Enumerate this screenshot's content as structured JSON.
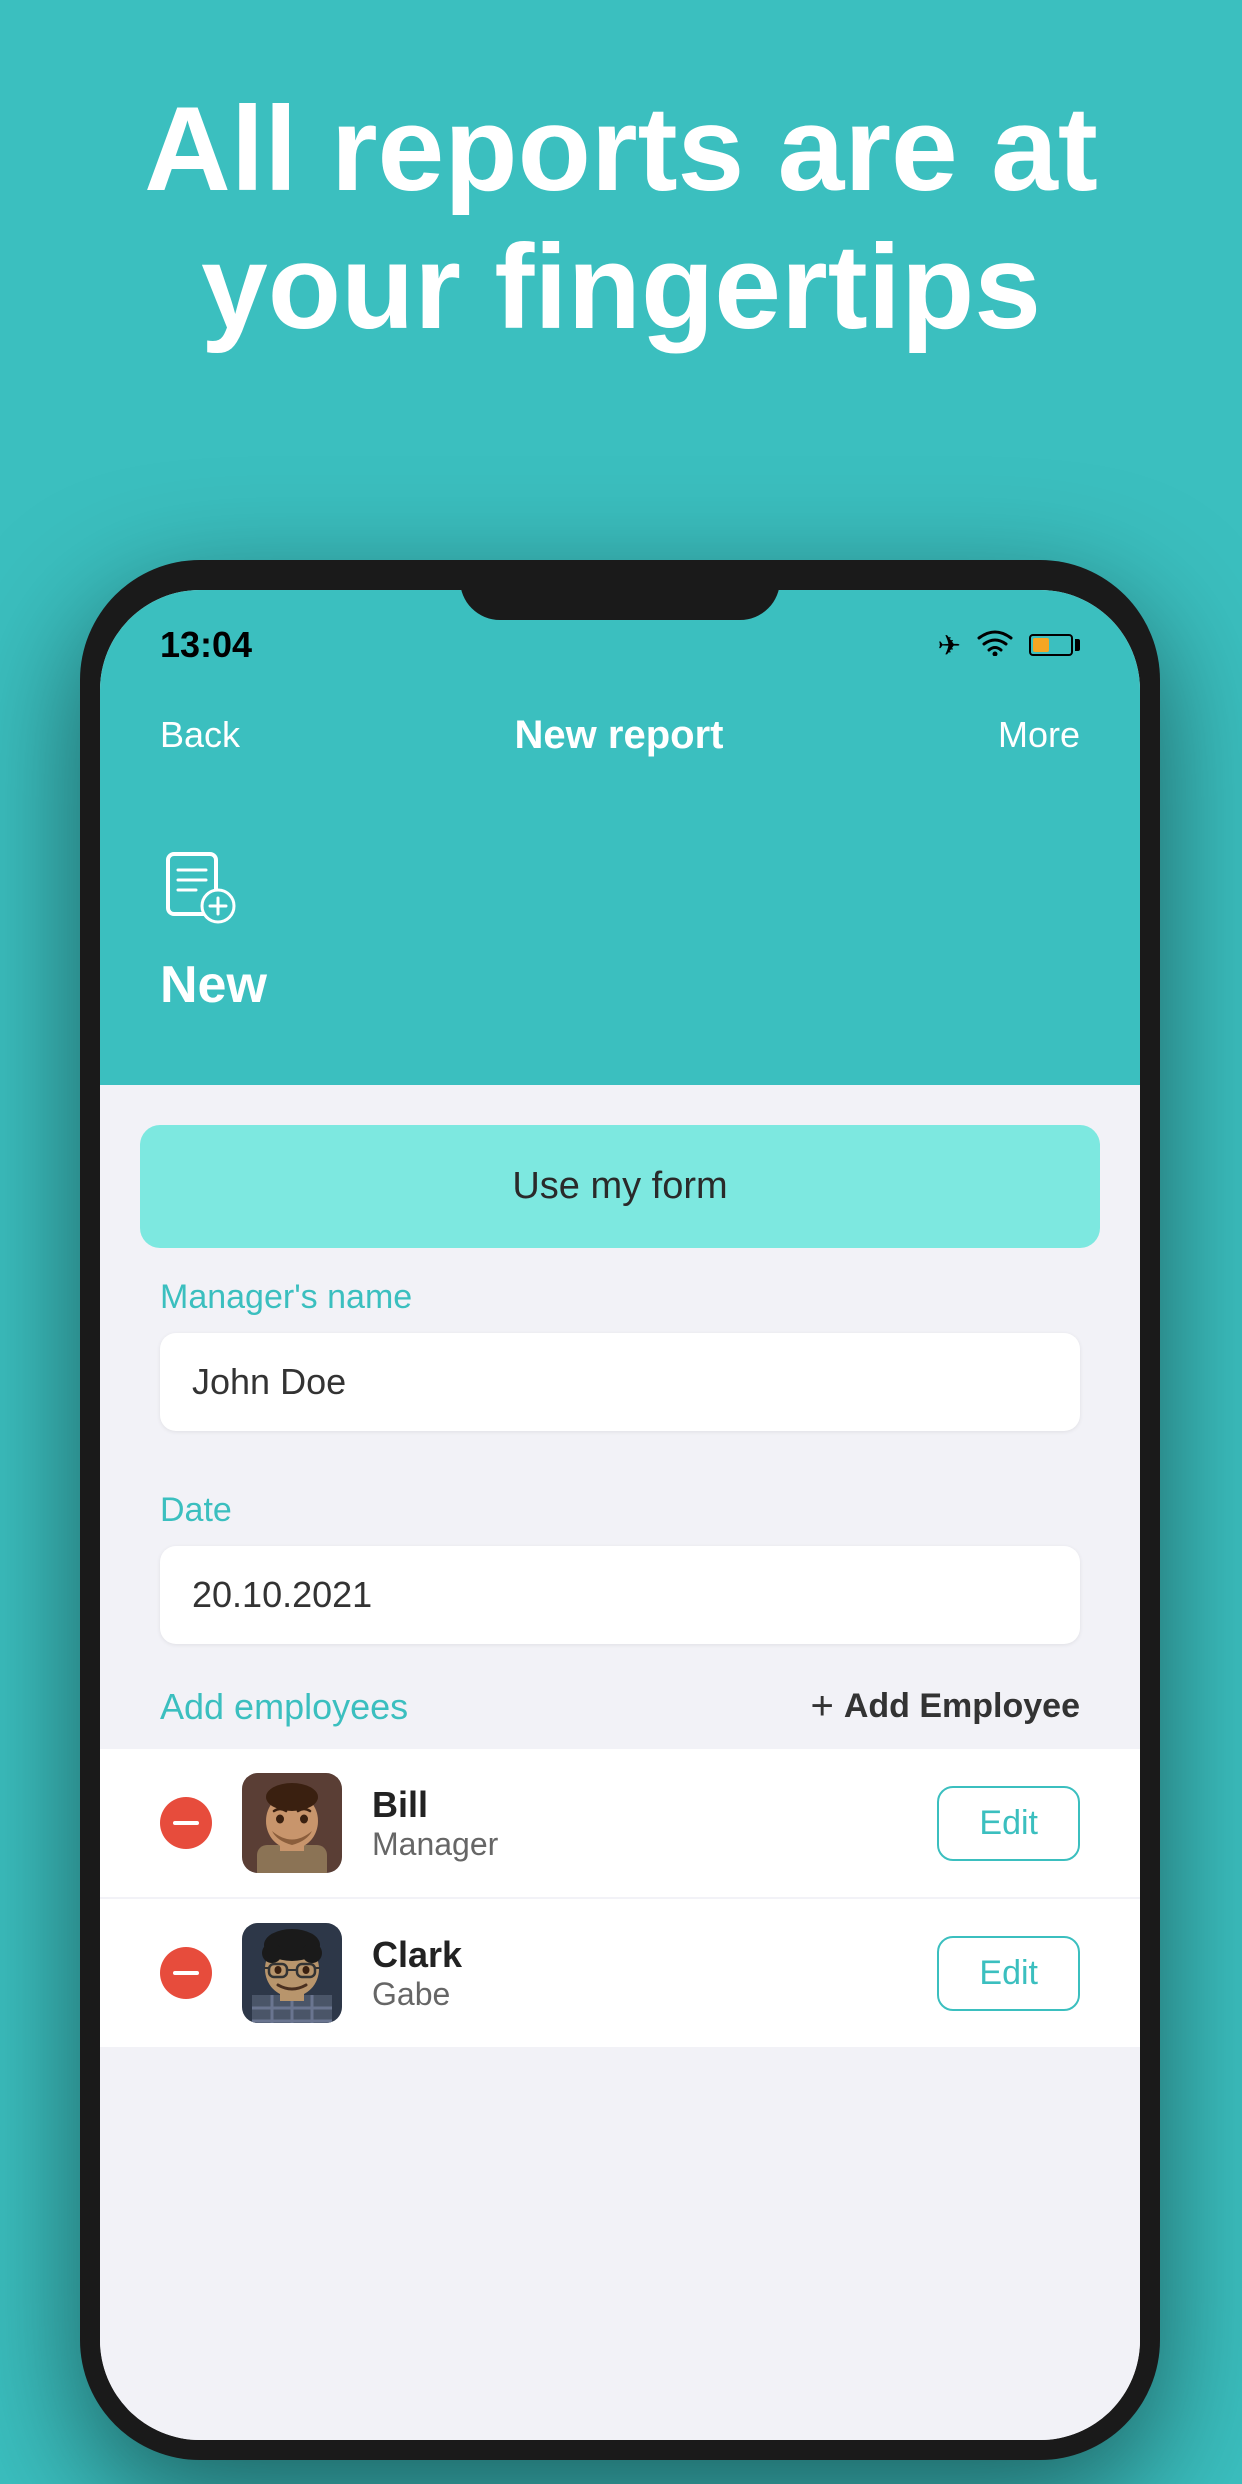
{
  "hero": {
    "title": "All reports are at your fingertips"
  },
  "status_bar": {
    "time": "13:04",
    "airplane_mode": "✈",
    "wifi": "wifi",
    "battery_level": "low"
  },
  "nav": {
    "back_label": "Back",
    "title": "New report",
    "more_label": "More"
  },
  "header_card": {
    "icon_label": "new-report-icon",
    "label": "New"
  },
  "form": {
    "use_form_button_label": "Use  my form",
    "manager_name_label": "Manager's name",
    "manager_name_value": "John Doe",
    "date_label": "Date",
    "date_value": "20.10.2021"
  },
  "employees": {
    "section_label": "Add employees",
    "add_button_label": "Add Employee",
    "items": [
      {
        "name": "Bill",
        "role": "Manager",
        "avatar_color": "#8B6354",
        "edit_label": "Edit"
      },
      {
        "name": "Clark",
        "role": "Gabe",
        "avatar_color": "#4a5568",
        "edit_label": "Edit"
      }
    ]
  },
  "colors": {
    "teal": "#3bbfbf",
    "teal_light": "#7de8e0",
    "red": "#e74c3c",
    "white": "#ffffff",
    "bg": "#f2f2f7"
  }
}
